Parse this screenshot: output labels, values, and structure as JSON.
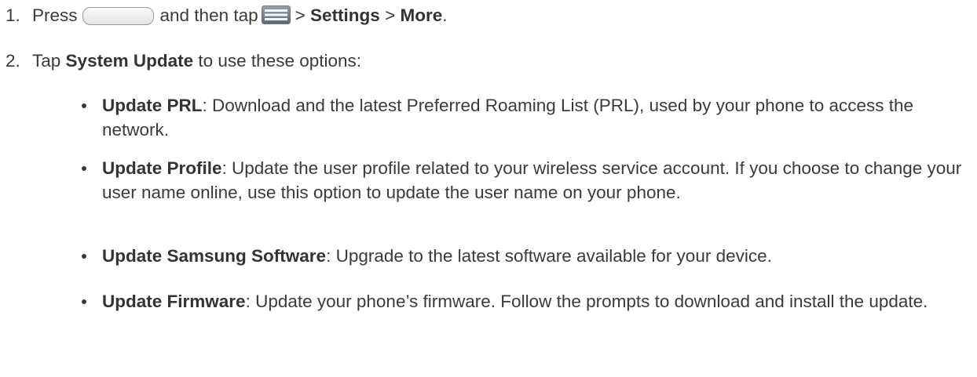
{
  "steps": [
    {
      "number": "1.",
      "press": "Press",
      "and_then_tap": "and then tap",
      "sep1": ">",
      "settings": "Settings",
      "sep2": ">",
      "more": "More",
      "end": "."
    },
    {
      "number": "2.",
      "tap": "Tap",
      "system_update": "System Update",
      "rest": "to use these options:"
    }
  ],
  "icons": {
    "home_key": "home-key-icon",
    "menu_key": "menu-key-icon"
  },
  "options": [
    {
      "title": "Update PRL",
      "desc": ": Download and the latest Preferred Roaming List (PRL), used by your phone to access the network."
    },
    {
      "title": "Update Profile",
      "desc": ": Update the user profile related to your wireless service account. If you choose to change your user name online, use this option to update the user name on your phone."
    },
    {
      "title": "Update Samsung Software",
      "desc": ": Upgrade to the latest software available for your device."
    },
    {
      "title": "Update Firmware",
      "desc": ": Update your phone’s firmware. Follow the prompts to download and install the update."
    }
  ]
}
